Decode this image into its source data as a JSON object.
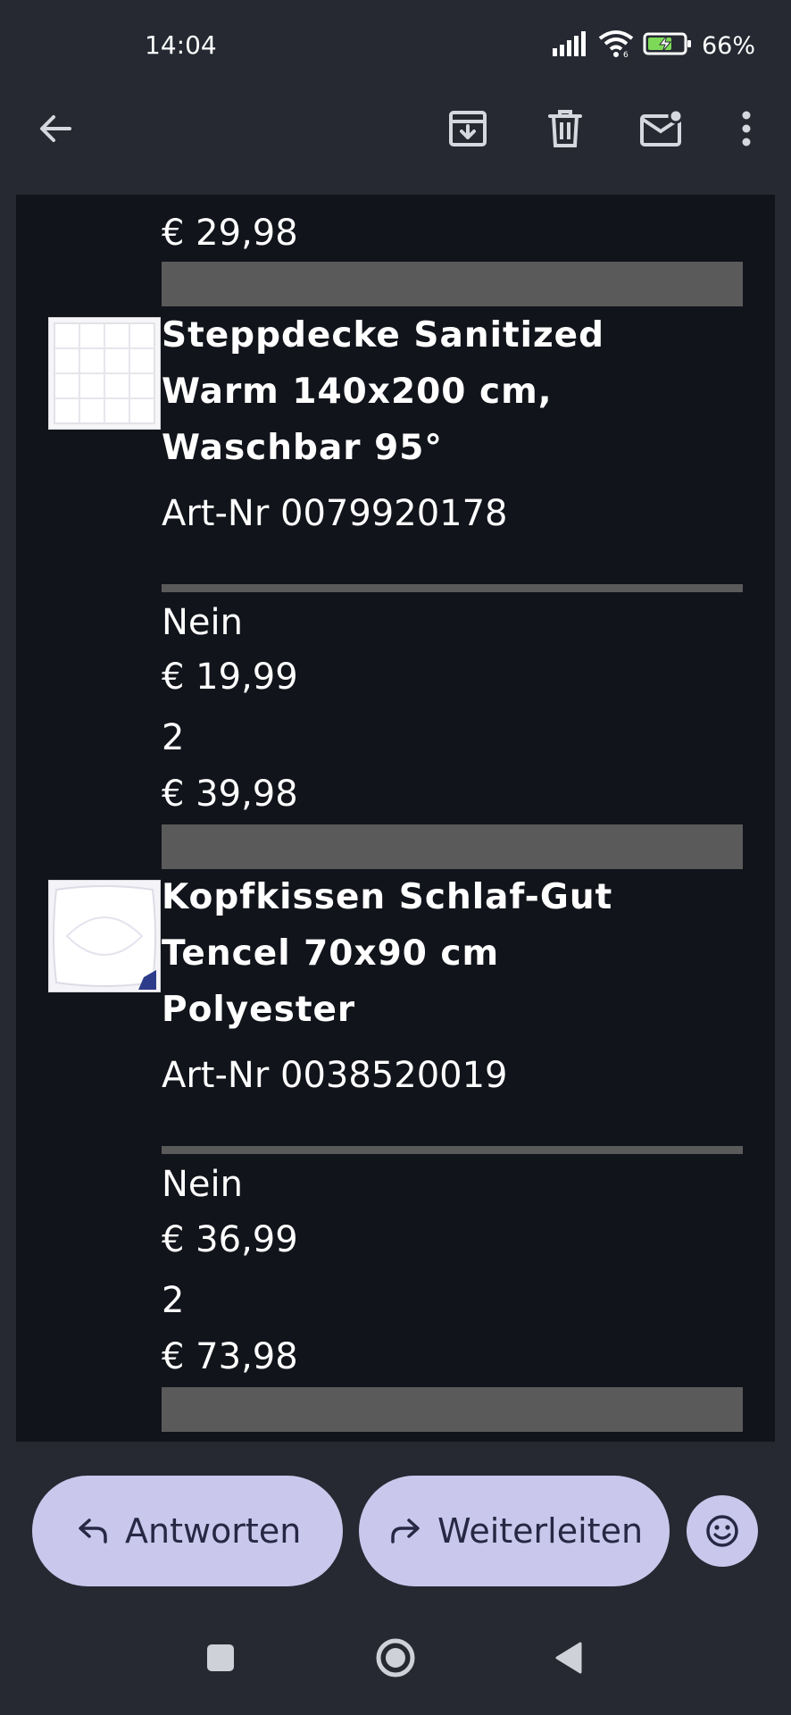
{
  "status_bar": {
    "time": "14:04",
    "battery": "66%",
    "icons": [
      "signal-icon",
      "wifi-icon",
      "battery-charging-icon"
    ]
  },
  "toolbar": {
    "back_icon": "arrow-left-icon",
    "archive_icon": "archive-icon",
    "delete_icon": "trash-icon",
    "mark_unread_icon": "mail-unread-icon",
    "more_icon": "more-vert-icon"
  },
  "email": {
    "top_total": "€ 29,98",
    "items": [
      {
        "title_lines": [
          "Steppdecke Sanitized",
          "Warm 140x200 cm,",
          "Waschbar 95°"
        ],
        "article_no": "Art-Nr 0079920178",
        "option": "Nein",
        "unit_price": "€ 19,99",
        "quantity": "2",
        "total": "€ 39,98"
      },
      {
        "title_lines": [
          "Kopfkissen Schlaf-Gut",
          "Tencel 70x90 cm",
          "Polyester"
        ],
        "article_no": "Art-Nr 0038520019",
        "option": "Nein",
        "unit_price": "€ 36,99",
        "quantity": "2",
        "total": "€ 73,98"
      }
    ]
  },
  "actions": {
    "reply_label": "Antworten",
    "forward_label": "Weiterleiten",
    "reply_icon": "reply-icon",
    "forward_icon": "forward-icon",
    "emoji_icon": "emoji-icon"
  },
  "nav": {
    "recents_icon": "square-icon",
    "home_icon": "circle-icon",
    "back_icon": "triangle-back-icon"
  },
  "colors": {
    "background": "#262932",
    "content_background": "#12141b",
    "pill": "#c9c8ec",
    "divider": "#5a5a5a"
  }
}
